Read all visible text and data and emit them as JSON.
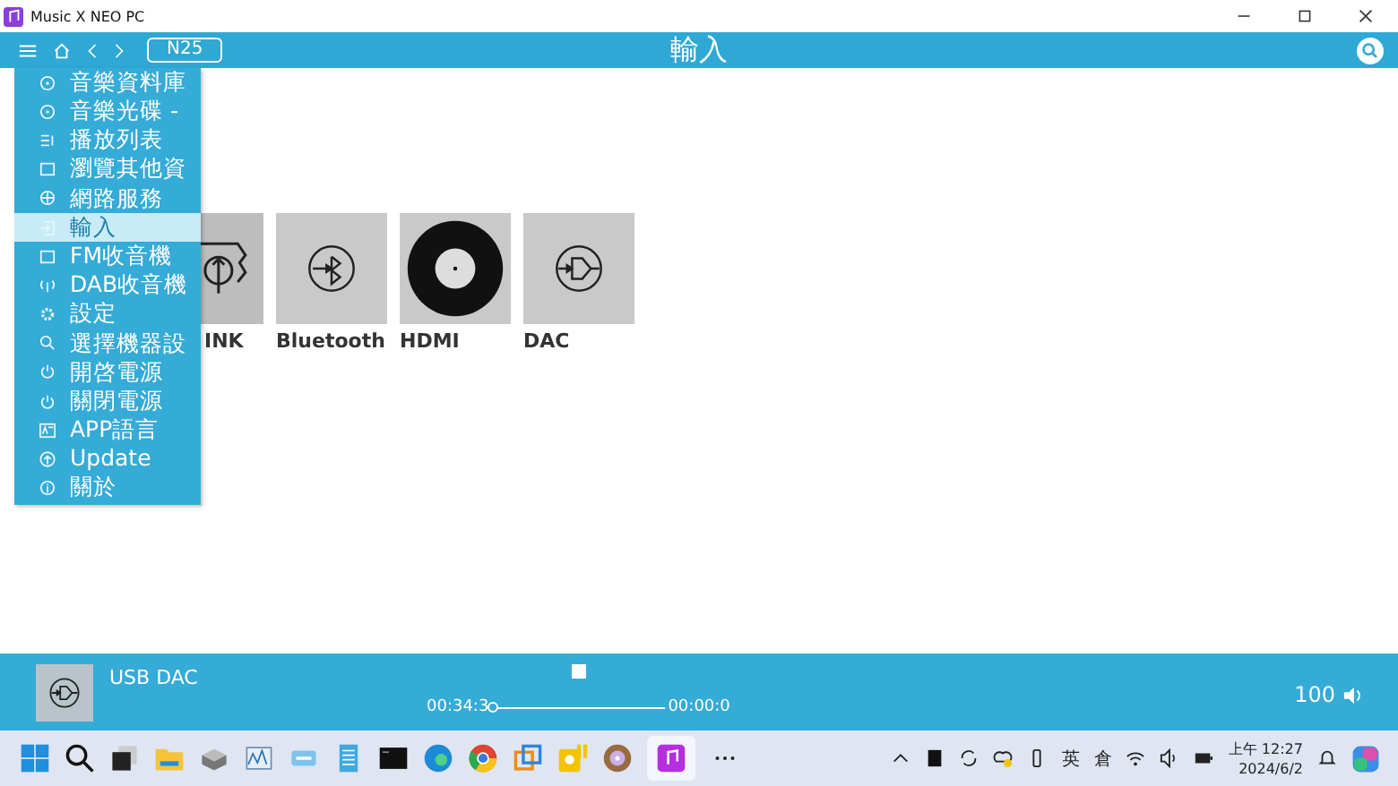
{
  "window": {
    "title": "Music X NEO PC"
  },
  "header": {
    "device": "N25",
    "title": "輸入"
  },
  "menu": [
    {
      "label": "音樂資料庫",
      "selected": false
    },
    {
      "label": "音樂光碟 -",
      "selected": false
    },
    {
      "label": "播放列表",
      "selected": false
    },
    {
      "label": "瀏覽其他資",
      "selected": false
    },
    {
      "label": "網路服務",
      "selected": false
    },
    {
      "label": "輸入",
      "selected": true
    },
    {
      "label": "FM收音機",
      "selected": false
    },
    {
      "label": "DAB收音機",
      "selected": false
    },
    {
      "label": "設定",
      "selected": false
    },
    {
      "label": "選擇機器設",
      "selected": false
    },
    {
      "label": "開啓電源",
      "selected": false
    },
    {
      "label": "關閉電源",
      "selected": false
    },
    {
      "label": "APP語言",
      "selected": false
    },
    {
      "label": "Update",
      "selected": false
    },
    {
      "label": "關於",
      "selected": false
    }
  ],
  "inputs": [
    {
      "label": "INK",
      "kind": "link"
    },
    {
      "label": "Bluetooth",
      "kind": "bluetooth"
    },
    {
      "label": "HDMI",
      "kind": "hdmi"
    },
    {
      "label": "DAC",
      "kind": "dac"
    }
  ],
  "player": {
    "source": "USB DAC",
    "elapsed": "00:34:3",
    "remaining": "00:00:0",
    "level": 0,
    "volume": "100"
  },
  "taskbar": {
    "tray": [
      "英",
      "倉"
    ],
    "time": "上午 12:27",
    "date": "2024/6/2"
  }
}
